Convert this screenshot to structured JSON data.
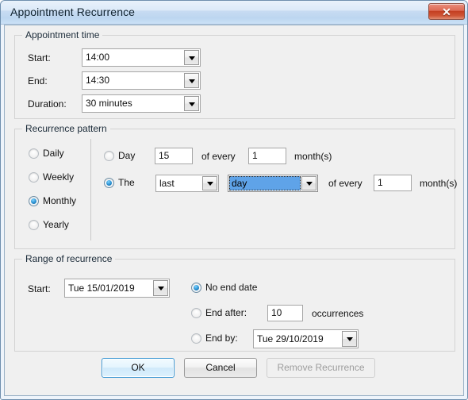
{
  "window": {
    "title": "Appointment Recurrence",
    "close_icon": "close-x-icon"
  },
  "appointment_time": {
    "group_title": "Appointment time",
    "start_label": "Start:",
    "start_value": "14:00",
    "end_label": "End:",
    "end_value": "14:30",
    "duration_label": "Duration:",
    "duration_value": "30 minutes"
  },
  "recurrence_pattern": {
    "group_title": "Recurrence pattern",
    "frequency_options": [
      {
        "label": "Daily",
        "checked": false
      },
      {
        "label": "Weekly",
        "checked": false
      },
      {
        "label": "Monthly",
        "checked": true
      },
      {
        "label": "Yearly",
        "checked": false
      }
    ],
    "day_radio_label": "Day",
    "day_radio_checked": false,
    "day_number_value": "15",
    "day_of_every_label": "of every",
    "day_months_value": "1",
    "day_months_label": "month(s)",
    "the_radio_label": "The",
    "the_radio_checked": true,
    "ordinal_value": "last",
    "weekday_value": "day",
    "the_of_every_label": "of every",
    "the_months_value": "1",
    "the_months_label": "month(s)"
  },
  "range_of_recurrence": {
    "group_title": "Range of recurrence",
    "start_label": "Start:",
    "start_value": "Tue 15/01/2019",
    "no_end_date_label": "No end date",
    "no_end_date_checked": true,
    "end_after_label": "End after:",
    "end_after_checked": false,
    "occurrences_value": "10",
    "occurrences_label": "occurrences",
    "end_by_label": "End by:",
    "end_by_checked": false,
    "end_by_value": "Tue 29/10/2019"
  },
  "footer": {
    "ok_label": "OK",
    "cancel_label": "Cancel",
    "remove_recurrence_label": "Remove Recurrence"
  }
}
